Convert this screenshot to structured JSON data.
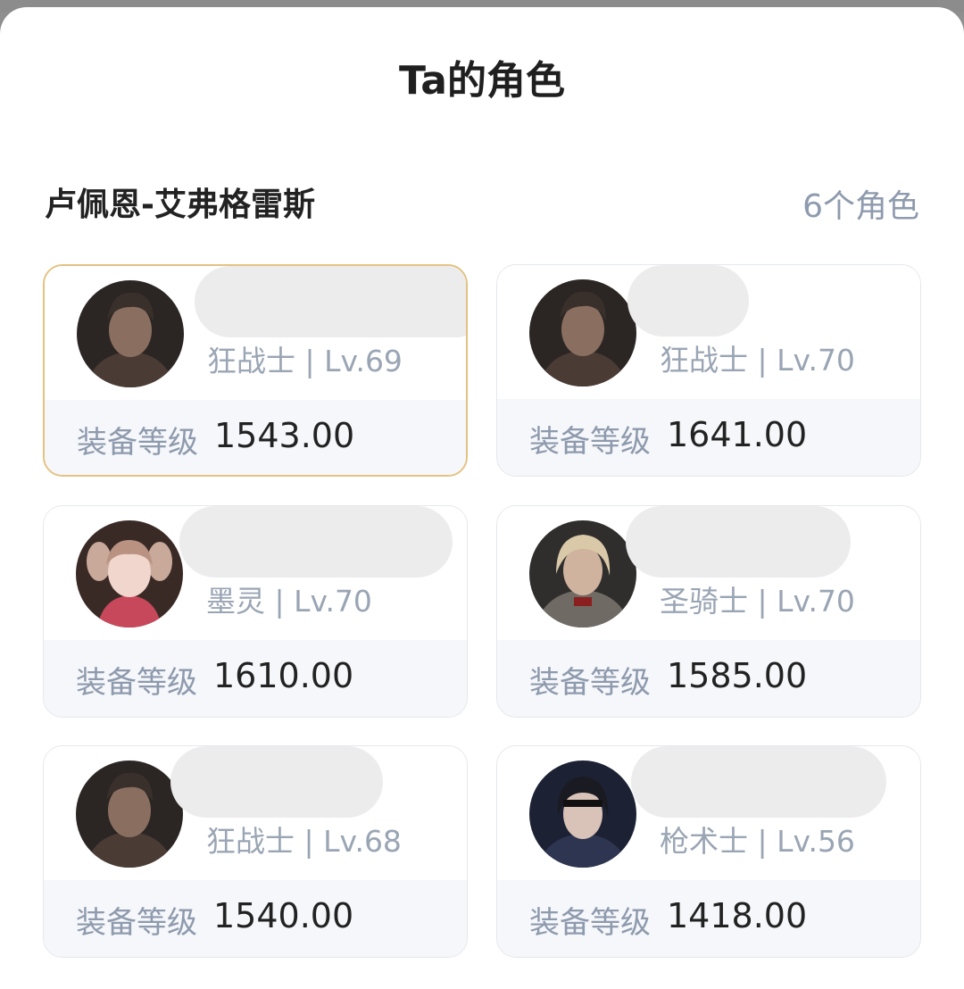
{
  "sheet": {
    "title": "Ta的角色",
    "server": "卢佩恩-艾弗格雷斯",
    "count": "6个角色"
  },
  "characters": [
    {
      "class_level": "狂战士 | Lv.69",
      "equip_label": "装备等级",
      "equip_value": "1543.00",
      "avatar": "berserker-portrait",
      "selected": true
    },
    {
      "class_level": "狂战士 | Lv.70",
      "equip_label": "装备等级",
      "equip_value": "1641.00",
      "avatar": "berserker-portrait",
      "selected": false
    },
    {
      "class_level": "墨灵 | Lv.70",
      "equip_label": "装备等级",
      "equip_value": "1610.00",
      "avatar": "artist-portrait",
      "selected": false
    },
    {
      "class_level": "圣骑士 | Lv.70",
      "equip_label": "装备等级",
      "equip_value": "1585.00",
      "avatar": "paladin-portrait",
      "selected": false
    },
    {
      "class_level": "狂战士 | Lv.68",
      "equip_label": "装备等级",
      "equip_value": "1540.00",
      "avatar": "berserker-portrait",
      "selected": false
    },
    {
      "class_level": "枪术士 | Lv.56",
      "equip_label": "装备等级",
      "equip_value": "1418.00",
      "avatar": "lancer-portrait",
      "selected": false
    }
  ],
  "colors": {
    "selected_border": "#e4c282",
    "muted_text": "#8e9aad"
  }
}
